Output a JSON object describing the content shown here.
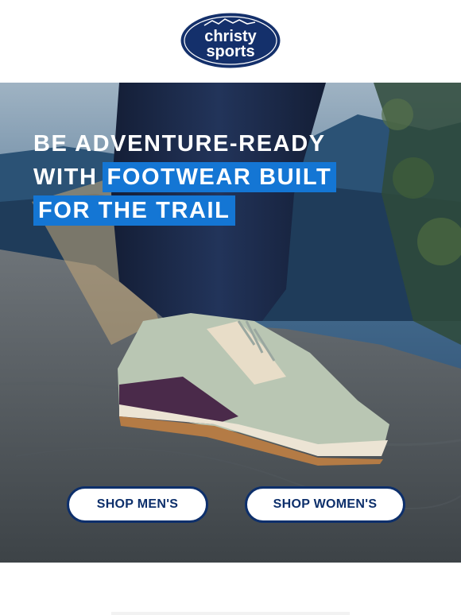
{
  "brand": {
    "logo_line1": "christy",
    "logo_line2": "sports",
    "color": "#14306b"
  },
  "hero": {
    "headline_line1": "BE ADVENTURE-READY",
    "headline_line2_plain": "WITH",
    "headline_line2_highlight": "FOOTWEAR BUILT",
    "headline_line3_highlight": "FOR THE TRAIL",
    "highlight_color": "#1476d4",
    "image_subject": "hiking-shoe-on-rock"
  },
  "buttons": {
    "shop_mens": "SHOP MEN'S",
    "shop_womens": "SHOP WOMEN'S"
  }
}
